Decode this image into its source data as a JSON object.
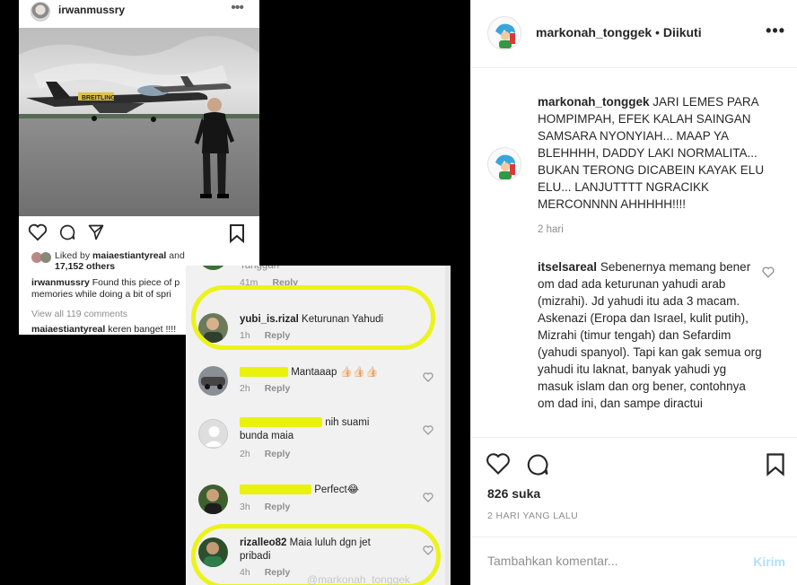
{
  "media": {
    "post": {
      "username": "irwanmussry",
      "more_glyph": "•••",
      "aircraft_text": "BREITLING",
      "likes_prefix": "Liked by",
      "likes_by": "maiaestiantyreal",
      "likes_and": "and",
      "likes_count": "17,152 others",
      "caption_user": "irwanmussry",
      "caption_line1": "Found this piece of p",
      "caption_line2": "memories while doing a bit of spri",
      "view_all": "View all 119 comments",
      "last_comment_user": "maiaestiantyreal",
      "last_comment_text": "keren banget !!!!"
    },
    "comments": [
      {
        "text": "Tanggan",
        "time": "41m",
        "reply": "Reply"
      },
      {
        "user": "yubi_is.rizal",
        "text": "Keturunan Yahudi",
        "time": "1h",
        "reply": "Reply"
      },
      {
        "text": "Mantaaap 👍🏻👍🏻👍🏻",
        "time": "2h",
        "reply": "Reply"
      },
      {
        "text_1": "nih suami",
        "text_2": "bunda maia",
        "time": "2h",
        "reply": "Reply"
      },
      {
        "text": "Perfect😂",
        "time": "3h",
        "reply": "Reply"
      },
      {
        "user": "rizalleo82",
        "text_1": "Maia luluh dgn jet",
        "text_2": "pribadi",
        "time": "4h",
        "reply": "Reply"
      }
    ],
    "watermark": "@markonah_tonggek"
  },
  "panel": {
    "header": {
      "username": "markonah_tonggek",
      "separator": "•",
      "follow_status": "Diikuti",
      "more_glyph": "•••"
    },
    "caption": {
      "username": "markonah_tonggek",
      "text": "JARI LEMES PARA HOMPIMPAH, EFEK KALAH SAINGAN SAMSARA NYONYIAH... MAAP YA BLEHHHH, DADDY LAKI NORMALITA... BUKAN TERONG DICABEIN KAYAK ELU ELU... LANJUTTTT NGRACIKK MERCONNNN AHHHHH!!!!",
      "time": "2 hari"
    },
    "comment": {
      "username": "itselsareal",
      "text": "Sebenernya memang bener om dad ada keturunan yahudi arab (mizrahi). Jd yahudi itu ada 3 macam. Askenazi (Eropa dan Israel, kulit putih), Mizrahi (timur tengah) dan Sefardim (yahudi spanyol). Tapi kan gak semua org yahudi itu laknat, banyak yahudi yg masuk islam dan org bener, contohnya om dad ini, dan sampe diractui"
    },
    "likes": "826 suka",
    "date": "2 HARI YANG LALU",
    "input": {
      "placeholder": "Tambahkan komentar..."
    },
    "post_button": "Kirim"
  },
  "colors": {
    "highlight": "#ecf31a",
    "post_disabled": "#b2dffc",
    "muted": "#8e8e8e",
    "text": "#262626"
  },
  "icons": [
    "heart-icon",
    "comment-icon",
    "share-icon",
    "bookmark-icon",
    "more-icon"
  ]
}
